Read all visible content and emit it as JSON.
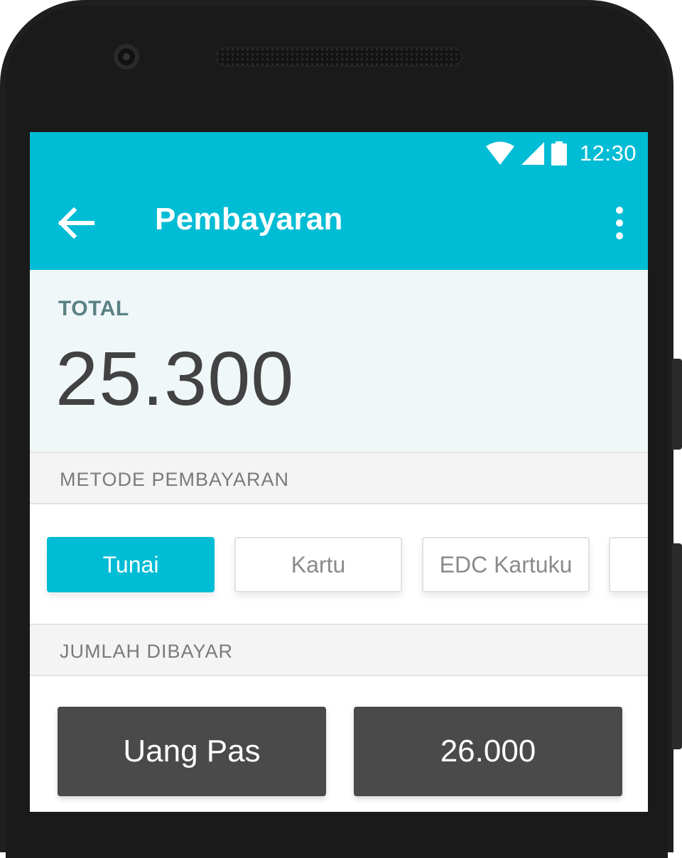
{
  "status_bar": {
    "time": "12:30"
  },
  "app_bar": {
    "title": "Pembayaran"
  },
  "total": {
    "label": "TOTAL",
    "value": "25.300"
  },
  "payment_method": {
    "header": "METODE PEMBAYARAN",
    "options": [
      {
        "label": "Tunai",
        "selected": true
      },
      {
        "label": "Kartu",
        "selected": false
      },
      {
        "label": "EDC Kartuku",
        "selected": false
      },
      {
        "label": "",
        "selected": false
      }
    ]
  },
  "amount_paid": {
    "header": "JUMLAH DIBAYAR",
    "options": [
      {
        "label": "Uang Pas"
      },
      {
        "label": "26.000"
      }
    ]
  },
  "colors": {
    "primary": "#00bcd4",
    "total_label": "#5a8184",
    "total_bg": "#f0f7f9",
    "amount_button": "#4a4a4a"
  },
  "icons": [
    "wifi-icon",
    "cell-signal-icon",
    "battery-icon",
    "arrow-back-icon",
    "more-vert-icon",
    "camera-icon",
    "speaker-icon"
  ]
}
